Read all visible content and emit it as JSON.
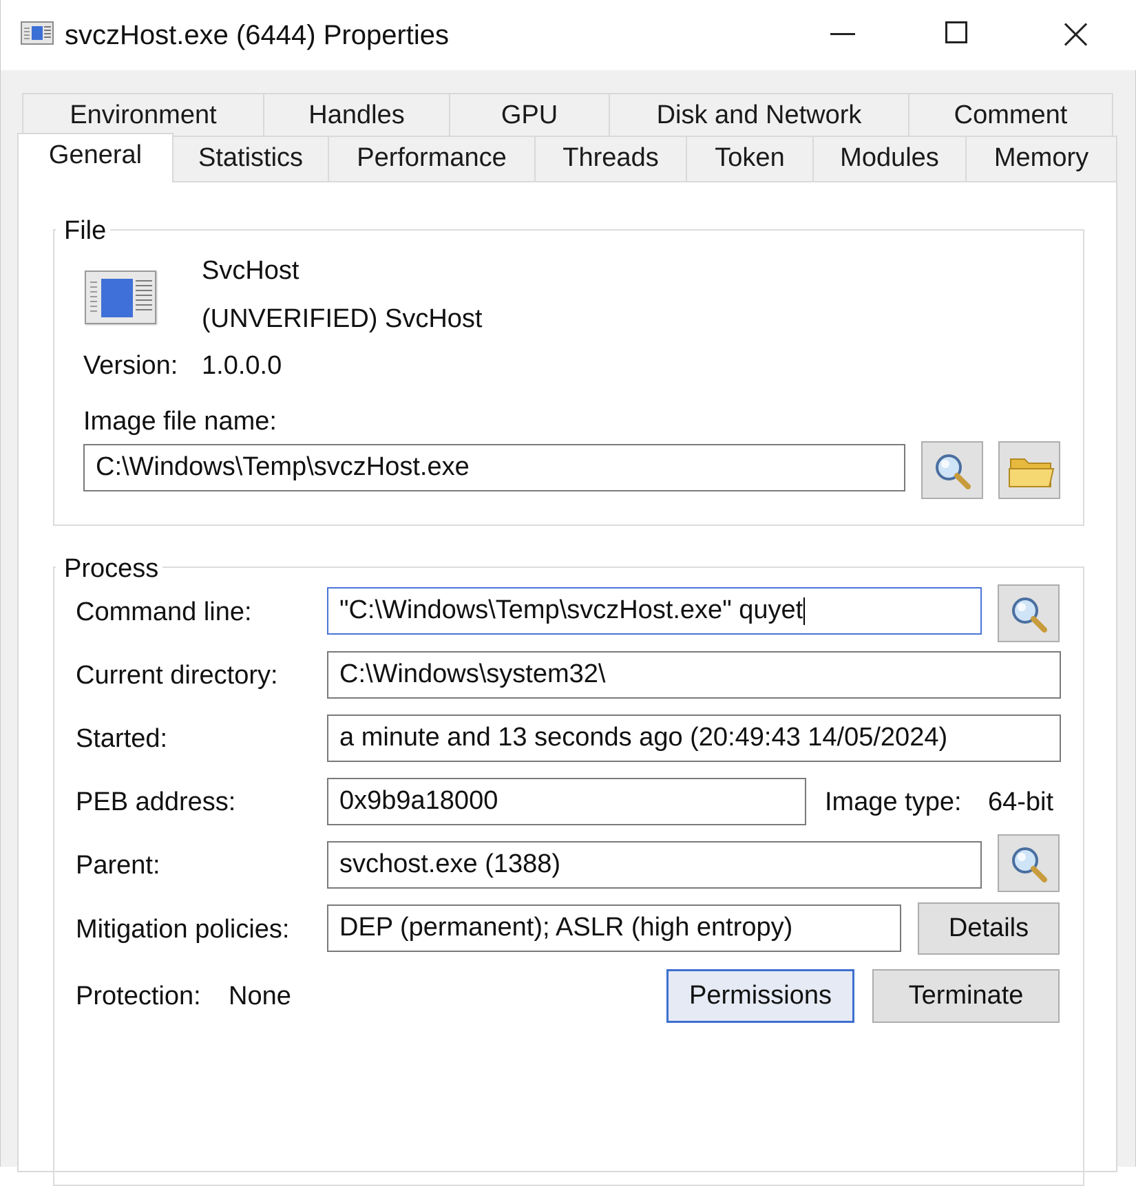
{
  "window": {
    "title": "svczHost.exe (6444) Properties"
  },
  "tabs": {
    "row1": [
      "Environment",
      "Handles",
      "GPU",
      "Disk and Network",
      "Comment"
    ],
    "row2": [
      "General",
      "Statistics",
      "Performance",
      "Threads",
      "Token",
      "Modules",
      "Memory"
    ],
    "active": "General"
  },
  "file": {
    "legend": "File",
    "description": "SvcHost",
    "company": "(UNVERIFIED) SvcHost",
    "version_label": "Version:",
    "version": "1.0.0.0",
    "image_file_label": "Image file name:",
    "image_file_value": "C:\\Windows\\Temp\\svczHost.exe"
  },
  "process": {
    "legend": "Process",
    "command_line_label": "Command line:",
    "command_line_value": "\"C:\\Windows\\Temp\\svczHost.exe\" quyet",
    "current_directory_label": "Current directory:",
    "current_directory_value": "C:\\Windows\\system32\\",
    "started_label": "Started:",
    "started_value": "a minute and 13 seconds ago (20:49:43 14/05/2024)",
    "peb_label": "PEB address:",
    "peb_value": "0x9b9a18000",
    "image_type_label": "Image type:",
    "image_type_value": "64-bit",
    "parent_label": "Parent:",
    "parent_value": "svchost.exe (1388)",
    "mitigation_label": "Mitigation policies:",
    "mitigation_value": "DEP (permanent); ASLR (high entropy)",
    "details_button": "Details",
    "protection_label": "Protection:",
    "protection_value": "None",
    "permissions_button": "Permissions",
    "terminate_button": "Terminate"
  },
  "icons": {
    "search": "magnifier-icon",
    "folder": "folder-icon",
    "app": "window-app-icon"
  },
  "colors": {
    "focus_border": "#4a74d6",
    "icon_blue": "#3f6fd8",
    "folder_yellow": "#f3d46b"
  }
}
